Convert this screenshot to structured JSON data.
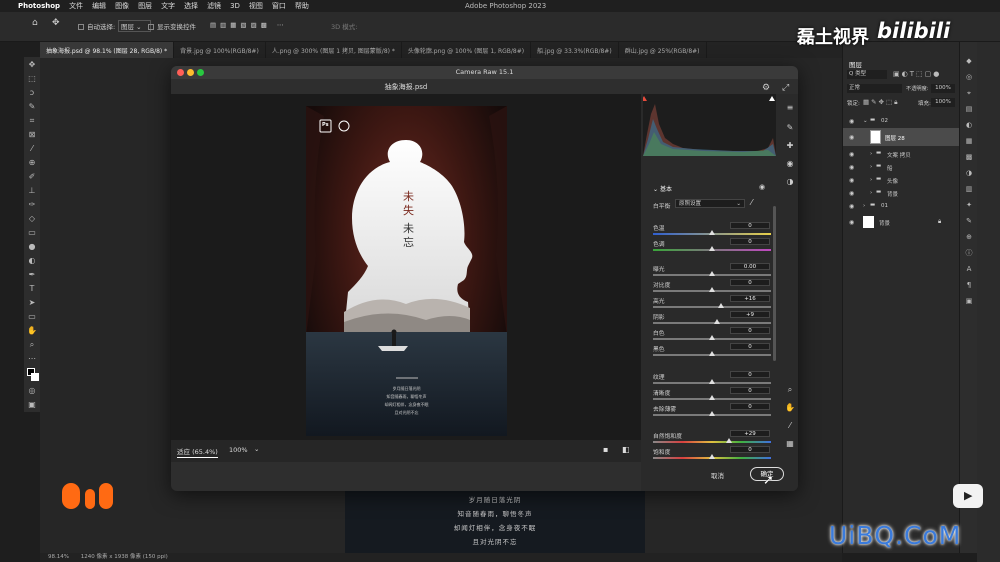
{
  "menubar": {
    "app": "Photoshop",
    "items": [
      "文件",
      "编辑",
      "图像",
      "图层",
      "文字",
      "选择",
      "滤镜",
      "3D",
      "视图",
      "窗口",
      "帮助"
    ],
    "window_title": "Adobe Photoshop 2023"
  },
  "options_bar": {
    "auto_select_label": "自动选择:",
    "auto_select_value": "图层",
    "show_transform_label": "显示变换控件",
    "mode_label": "3D 模式:"
  },
  "doc_tabs": [
    {
      "label": "抽象海报.psd @ 98.1% (图层 28, RGB/8) *",
      "active": true
    },
    {
      "label": "背景.jpg @ 100%(RGB/8#)",
      "active": false
    },
    {
      "label": "人.png @ 300% (图层 1 拷贝, 图层蒙版/8) *",
      "active": false
    },
    {
      "label": "头像轮廓.png @ 100% (图层 1, RGB/8#)",
      "active": false
    },
    {
      "label": "船.jpg @ 33.3%(RGB/8#)",
      "active": false
    },
    {
      "label": "群山.jpg @ 25%(RGB/8#)",
      "active": false
    }
  ],
  "dialog": {
    "title": "Camera Raw 15.1",
    "filename": "抽象海报.psd",
    "zoom_fit": "适应 (65.4%)",
    "zoom_100": "100%",
    "cancel": "取消",
    "ok": "确定"
  },
  "poster": {
    "title_chars": [
      "未",
      "失",
      "未",
      "忘"
    ],
    "lines": [
      "岁月随日落光阴",
      "知音随春雨，聊悟冬声",
      "却闻灯相伴，念身夜不眠",
      "且对光阴不忘"
    ]
  },
  "basic_panel": {
    "section_label": "基本",
    "wb_label": "白平衡",
    "wb_value": "原照设置",
    "sliders": [
      {
        "label": "色温",
        "value": "0",
        "pos": 0.5,
        "group": "wb"
      },
      {
        "label": "色调",
        "value": "0",
        "pos": 0.5,
        "group": "wb"
      },
      {
        "label": "曝光",
        "value": "0.00",
        "pos": 0.5,
        "group": "tone"
      },
      {
        "label": "对比度",
        "value": "0",
        "pos": 0.5,
        "group": "tone"
      },
      {
        "label": "高光",
        "value": "+16",
        "pos": 0.58,
        "group": "tone"
      },
      {
        "label": "阴影",
        "value": "+9",
        "pos": 0.545,
        "group": "tone"
      },
      {
        "label": "白色",
        "value": "0",
        "pos": 0.5,
        "group": "tone"
      },
      {
        "label": "黑色",
        "value": "0",
        "pos": 0.5,
        "group": "tone"
      },
      {
        "label": "纹理",
        "value": "0",
        "pos": 0.5,
        "group": "presence"
      },
      {
        "label": "清晰度",
        "value": "0",
        "pos": 0.5,
        "group": "presence"
      },
      {
        "label": "去除薄雾",
        "value": "0",
        "pos": 0.5,
        "group": "presence"
      },
      {
        "label": "自然饱和度",
        "value": "+29",
        "pos": 0.645,
        "group": "sat"
      },
      {
        "label": "饱和度",
        "value": "0",
        "pos": 0.5,
        "group": "sat"
      }
    ]
  },
  "layers_panel": {
    "tab_label": "图层",
    "filter_label": "Q 类型",
    "blend_mode": "正常",
    "opacity_label": "不透明度:",
    "opacity_value": "100%",
    "lock_label": "锁定:",
    "fill_label": "填充:",
    "fill_value": "100%",
    "layers": [
      {
        "name": "02",
        "type": "group",
        "indent": 0
      },
      {
        "name": "图层 28",
        "type": "layer",
        "indent": 1,
        "selected": true
      },
      {
        "name": "文案 拷贝",
        "type": "group",
        "indent": 1
      },
      {
        "name": "船",
        "type": "group",
        "indent": 1
      },
      {
        "name": "头像",
        "type": "group",
        "indent": 1
      },
      {
        "name": "背景",
        "type": "group",
        "indent": 1
      },
      {
        "name": "01",
        "type": "group",
        "indent": 0
      },
      {
        "name": "背景",
        "type": "background",
        "indent": 0
      }
    ]
  },
  "status_bar": {
    "zoom": "98.14%",
    "size": "1240 像素 x 1938 像素 (150 ppi)"
  },
  "watermarks": {
    "channel": "磊土视界",
    "bilibili": "bilibili",
    "site": "UiBQ.CoM"
  },
  "colors": {
    "accent_orange": "#ff6a13",
    "ok_border": "#dddddd",
    "watermark_blue": "#3a7bdc"
  }
}
